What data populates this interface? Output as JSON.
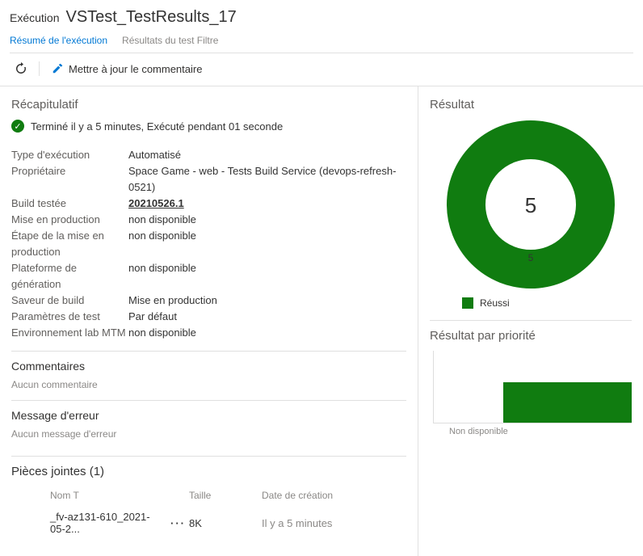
{
  "header": {
    "label": "Exécution",
    "name": "VSTest_TestResults_17"
  },
  "tabs": {
    "summary": "Résumé de l'exécution",
    "filter": "Résultats du test Filtre"
  },
  "toolbar": {
    "update_comment": "Mettre à jour le commentaire"
  },
  "summary": {
    "title": "Récapitulatif",
    "status_text": "Terminé il y a 5 minutes, Exécuté pendant 01 seconde",
    "fields": {
      "type_label": "Type d'exécution",
      "type_value": "Automatisé",
      "owner_label": "Propriétaire",
      "owner_value": "Space Game - web - Tests Build Service (devops-refresh-0521)",
      "build_label": "Build testée",
      "build_value": "20210526.1",
      "release_label": "Mise en production",
      "release_value": "non disponible",
      "stage_label": "Étape de la mise en production",
      "stage_value": "non disponible",
      "platform_label": "Plateforme de génération",
      "platform_value": "non disponible",
      "flavor_label": "Saveur de build",
      "flavor_value": "Mise en production",
      "params_label": "Paramètres de test",
      "params_value": "Par défaut",
      "lab_label": "Environnement lab MTM",
      "lab_value": "non disponible"
    },
    "comments_title": "Commentaires",
    "comments_empty": "Aucun commentaire",
    "error_title": "Message d'erreur",
    "error_empty": "Aucun message d'erreur"
  },
  "attachments": {
    "title": "Pièces jointes (1)",
    "cols": {
      "name": "Nom T",
      "size": "Taille",
      "date": "Date de création"
    },
    "items": [
      {
        "name": "_fv-az131-610_2021-05-2...",
        "size": "8K",
        "date": "Il y a 5 minutes"
      }
    ]
  },
  "result": {
    "title": "Résultat",
    "total": "5",
    "passed_label": "5",
    "legend_passed": "Réussi"
  },
  "priority": {
    "title": "Résultat par priorité",
    "label": "Non disponible"
  },
  "chart_data": {
    "type": "pie",
    "title": "Résultat",
    "series": [
      {
        "name": "Réussi",
        "value": 5,
        "color": "#107c10"
      }
    ],
    "total": 5
  }
}
